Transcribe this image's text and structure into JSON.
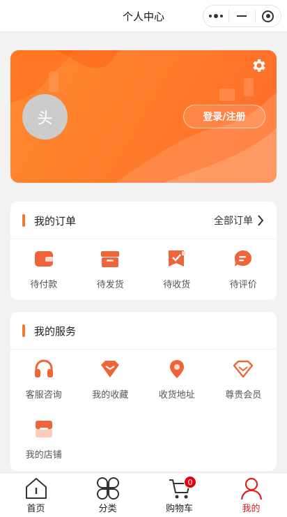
{
  "window": {
    "title": "个人中心"
  },
  "profile": {
    "avatar_text": "头",
    "login_label": "登录/注册"
  },
  "colors": {
    "accent": "#f07a2c",
    "icon": "#f0643a",
    "active_tab": "#e02020",
    "badge": "#e60012"
  },
  "orders": {
    "title": "我的订单",
    "all_label": "全部订单",
    "items": [
      {
        "label": "待付款",
        "icon": "wallet-icon"
      },
      {
        "label": "待发货",
        "icon": "box-icon"
      },
      {
        "label": "待收货",
        "icon": "delivery-icon"
      },
      {
        "label": "待评价",
        "icon": "comment-icon"
      }
    ]
  },
  "services": {
    "title": "我的服务",
    "items": [
      {
        "label": "客服咨询",
        "icon": "headset-icon"
      },
      {
        "label": "我的收藏",
        "icon": "heart-gem-icon"
      },
      {
        "label": "收货地址",
        "icon": "location-pin-icon"
      },
      {
        "label": "尊贵会员",
        "icon": "diamond-icon"
      },
      {
        "label": "我的店铺",
        "icon": "store-icon"
      }
    ]
  },
  "tabbar": {
    "items": [
      {
        "label": "首页",
        "icon": "home-icon",
        "active": false
      },
      {
        "label": "分类",
        "icon": "category-icon",
        "active": false
      },
      {
        "label": "购物车",
        "icon": "cart-icon",
        "active": false,
        "badge": "0"
      },
      {
        "label": "我的",
        "icon": "user-icon",
        "active": true
      }
    ]
  }
}
